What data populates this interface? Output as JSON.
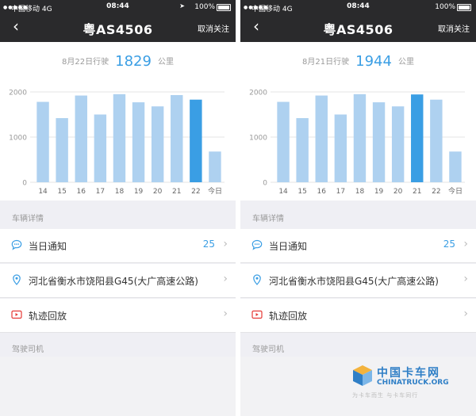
{
  "colors": {
    "bar": "#aed1f0",
    "bar_highlight": "#3a9ee4",
    "accent": "#3a9ee4",
    "header_bg": "#2a2a2c"
  },
  "phones": [
    {
      "status": {
        "carrier": "中国移动  4G",
        "time": "08:44",
        "battery": "100%"
      },
      "nav": {
        "back_icon": "chevron-left-icon",
        "title": "粤AS4506",
        "unfollow": "取消关注"
      },
      "summary": {
        "prefix": "8月22日行驶",
        "value": "1829",
        "unit": "公里"
      },
      "chart_data": {
        "type": "bar",
        "categories": [
          "14",
          "15",
          "16",
          "17",
          "18",
          "19",
          "20",
          "21",
          "22",
          "今日"
        ],
        "values": [
          1780,
          1420,
          1920,
          1500,
          1950,
          1770,
          1680,
          1930,
          1829,
          680
        ],
        "highlight_index": 8,
        "yticks": [
          "0",
          "1000",
          "2000"
        ],
        "ylim": [
          0,
          2000
        ]
      },
      "vehicle_details_label": "车辆详情",
      "rows": [
        {
          "icon": "chat-bubble-icon",
          "label": "当日通知",
          "count": "25"
        },
        {
          "icon": "location-pin-icon",
          "label": "河北省衡水市饶阳县G45(大广高速公路)"
        },
        {
          "icon": "video-play-icon",
          "label": "轨迹回放"
        }
      ],
      "driver_label": "驾驶司机"
    },
    {
      "status": {
        "carrier": "中国移动  4G",
        "time": "08:44",
        "battery": "100%"
      },
      "nav": {
        "back_icon": "chevron-left-icon",
        "title": "粤AS4506",
        "unfollow": "取消关注"
      },
      "summary": {
        "prefix": "8月21日行驶",
        "value": "1944",
        "unit": "公里"
      },
      "chart_data": {
        "type": "bar",
        "categories": [
          "14",
          "15",
          "16",
          "17",
          "18",
          "19",
          "20",
          "21",
          "22",
          "今日"
        ],
        "values": [
          1780,
          1420,
          1920,
          1500,
          1950,
          1770,
          1680,
          1944,
          1829,
          680
        ],
        "highlight_index": 7,
        "yticks": [
          "0",
          "1000",
          "2000"
        ],
        "ylim": [
          0,
          2000
        ]
      },
      "vehicle_details_label": "车辆详情",
      "rows": [
        {
          "icon": "chat-bubble-icon",
          "label": "当日通知",
          "count": "25"
        },
        {
          "icon": "location-pin-icon",
          "label": "河北省衡水市饶阳县G45(大广高速公路)"
        },
        {
          "icon": "video-play-icon",
          "label": "轨迹回放"
        }
      ],
      "driver_label": "驾驶司机"
    }
  ],
  "watermark": {
    "name": "中国卡车网",
    "domain": "CHINATRUCK.ORG",
    "slogan": "为卡车而生  与卡车同行"
  }
}
